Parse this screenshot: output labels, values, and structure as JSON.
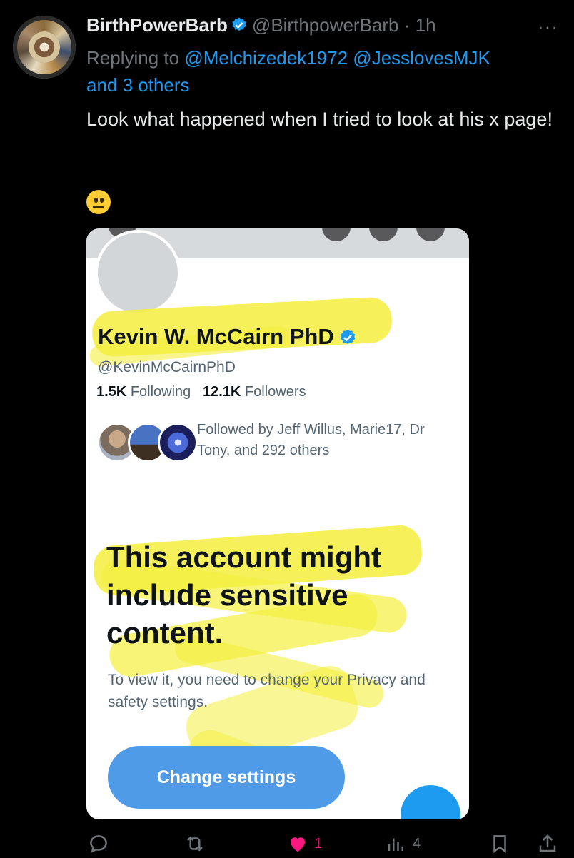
{
  "post": {
    "display_name": "BirthPowerBarb",
    "handle": "@BirthpowerBarb",
    "separator": "·",
    "time": "1h",
    "more": "···",
    "replying_prefix": "Replying to",
    "reply_mention_1": "@Melchizedek1972",
    "reply_mention_2": "@JesslovesMJK",
    "reply_others": "and 3 others",
    "text": "Look what happened when I tried to look at his x page!",
    "emoji_name": "neutral-face-emoji"
  },
  "embedded_image": {
    "profile_name": "Kevin W. McCairn PhD",
    "profile_handle": "@KevinMcCairnPhD",
    "following_count": "1.5K",
    "following_label": "Following",
    "followers_count": "12.1K",
    "followers_label": "Followers",
    "followed_by": "Followed by Jeff Willus, Marie17, Dr Tony, and 292 others",
    "sensitive_heading": "This account might include sensitive content.",
    "privacy_text": "To view it, you need to change your Privacy and safety settings.",
    "button_label": "Change settings"
  },
  "actions": {
    "reply_icon": "reply-icon",
    "retweet_icon": "retweet-icon",
    "like_icon": "heart-icon",
    "like_count": "1",
    "views_icon": "views-icon",
    "views_count": "4",
    "bookmark_icon": "bookmark-icon",
    "share_icon": "share-icon"
  },
  "colors": {
    "background": "#000000",
    "link": "#1d9bf0",
    "secondary_text": "#71767b",
    "like": "#f91880",
    "highlight": "#f4ef3e"
  }
}
